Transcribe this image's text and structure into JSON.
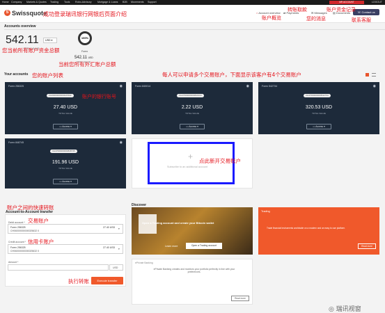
{
  "topnav": {
    "items": [
      "Home",
      "Company",
      "Markets & Quotes",
      "Trading",
      "Tools",
      "Robo-Advisory",
      "Mortgage & Loans",
      "B2B",
      "Movements",
      "Support"
    ],
    "account": "MR ACCOUNT",
    "logout": "LOGOUT"
  },
  "header": {
    "brand": "Swissquote",
    "links": [
      "Account overview",
      "Payments",
      "Messages",
      "Documents"
    ],
    "contact": "Contact us"
  },
  "overview": {
    "title": "Accounts overview",
    "total": "542.11",
    "currency": "USD",
    "total_label": "TOTAL VALUE",
    "ring_pct": "100%",
    "forex_label": "Forex",
    "forex_amount": "542.11",
    "forex_currency": "USD",
    "forex_total_label": "TOTAL VALUE"
  },
  "accounts": {
    "title": "Your accounts",
    "cards": [
      {
        "id": "Forex 256325",
        "pill": "CH00000000000025632",
        "amount": "27.40 USD",
        "total_label": "TOTAL VALUE",
        "access": "Access"
      },
      {
        "id": "Forex 840014",
        "pill": "CH47000000000840014",
        "amount": "2.22 USD",
        "total_label": "TOTAL VALUE",
        "access": "Access"
      },
      {
        "id": "Forex 542734",
        "pill": "CH47000000000542734",
        "amount": "320.53 USD",
        "total_label": "TOTAL VALUE",
        "access": "Access"
      },
      {
        "id": "Forex 848745",
        "pill": "CH47000000000848745",
        "amount": "191.96 USD",
        "total_label": "TOTAL VALUE",
        "access": "Access"
      }
    ],
    "add_label": "Subscribe to an additional account"
  },
  "transfer": {
    "title": "Account-to-Account transfer",
    "debit_label": "Debit account *",
    "debit_acc": "Forex 256325",
    "debit_iban": "CH06000000000025632 0",
    "debit_amount": "27.40 USD",
    "credit_label": "Credit account *",
    "credit_acc": "Forex 256325",
    "credit_iban": "CH06000000000025632 0",
    "credit_amount": "27.40 USD",
    "amount_label": "Amount *",
    "amount_currency": "USD",
    "button": "Execute transfer"
  },
  "discover": {
    "title": "Discover",
    "banner_text": "Open a Trading account and create your Bitcoin wallet",
    "learn_more": "Learn more",
    "banner_btn": "Open a Trading account",
    "trading_title": "Trading",
    "trading_text": "Trade financial instruments worldwide on a modern and an easy to use platform.",
    "trading_btn": "Read more",
    "eprivate_title": "ePrivate Banking",
    "eprivate_text": "ePrivate Banking creates and monitors your portfolio perfectly in line with your preferences.",
    "eprivate_btn": "Read more"
  },
  "annotations": {
    "header_intro": "成功登录瑞讯银行网银后页面介绍",
    "overview": "账户概览",
    "payments": "转账取款",
    "messages": "您的消息",
    "documents": "账户资金记录",
    "contact": "联系客服",
    "total": "您当前所有账户资金总额",
    "forex": "当前您所有外汇账户总额",
    "your_accounts": "您的账户列表",
    "multi": "每人可以申请多个交易账户，下面显示该客户有4个交易账户",
    "bank_no": "账户的银行账号",
    "new_acc": "点此新开交易账户",
    "quick": "账户之间的快速转账",
    "trade_acc": "交易账户",
    "credit_acc": "信用卡账户",
    "execute": "执行转账",
    "watermark": "瑞讯视窗"
  },
  "colors": {
    "brand_red": "#d0282c",
    "card_bg": "#1d2a3a",
    "orange": "#f0592b",
    "annotation": "#e4141c",
    "highlight_box": "#1a1aff"
  }
}
